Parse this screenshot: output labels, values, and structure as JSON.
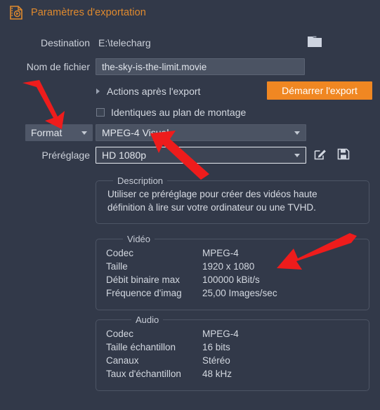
{
  "window": {
    "title": "Paramètres d'exportation",
    "title_icon": "export-video-icon",
    "accent_color": "#e08a2e",
    "background_color": "#323949"
  },
  "form": {
    "destination_label": "Destination",
    "destination_value": "E:\\telecharg",
    "browse_icon": "folder-icon",
    "filename_label": "Nom de fichier",
    "filename_value": "the-sky-is-the-limit.movie",
    "filename_placeholder": "Nom de fichier",
    "actions_after_export_label": "Actions après l'export",
    "actions_after_export_icon": "chevron-right-icon",
    "start_export_label": "Démarrer l'export",
    "start_export_color": "#f08722",
    "same_as_timeline_label": "Identiques au plan de montage",
    "same_as_timeline_checked": false,
    "format_button_label": "Format",
    "format_value": "MPEG-4 Visual",
    "preset_label": "Préréglage",
    "preset_value": "HD 1080p",
    "edit_icon": "edit-pencil-icon",
    "save_icon": "floppy-save-icon"
  },
  "description": {
    "legend": "Description",
    "text": "Utiliser ce préréglage pour créer des vidéos haute définition à lire sur votre ordinateur ou une TVHD."
  },
  "video": {
    "legend": "Vidéo",
    "rows": [
      {
        "key": "Codec",
        "value": "MPEG-4"
      },
      {
        "key": "Taille",
        "value": "1920 x 1080"
      },
      {
        "key": "Débit binaire max",
        "value": "100000 kBit/s"
      },
      {
        "key": "Fréquence d'imag",
        "value": "25,00 Images/sec"
      }
    ]
  },
  "audio": {
    "legend": "Audio",
    "rows": [
      {
        "key": "Codec",
        "value": "MPEG-4"
      },
      {
        "key": "Taille échantillon",
        "value": "16 bits"
      },
      {
        "key": "Canaux",
        "value": "Stéréo"
      },
      {
        "key": "Taux d'échantillon",
        "value": "48 kHz"
      }
    ]
  },
  "annotations": {
    "color": "#ee1c1c",
    "arrows": [
      {
        "name": "arrow-to-format-button",
        "direction": "down-right"
      },
      {
        "name": "arrow-to-format-combo",
        "direction": "up-left"
      },
      {
        "name": "arrow-to-video-size",
        "direction": "down-left"
      }
    ]
  }
}
